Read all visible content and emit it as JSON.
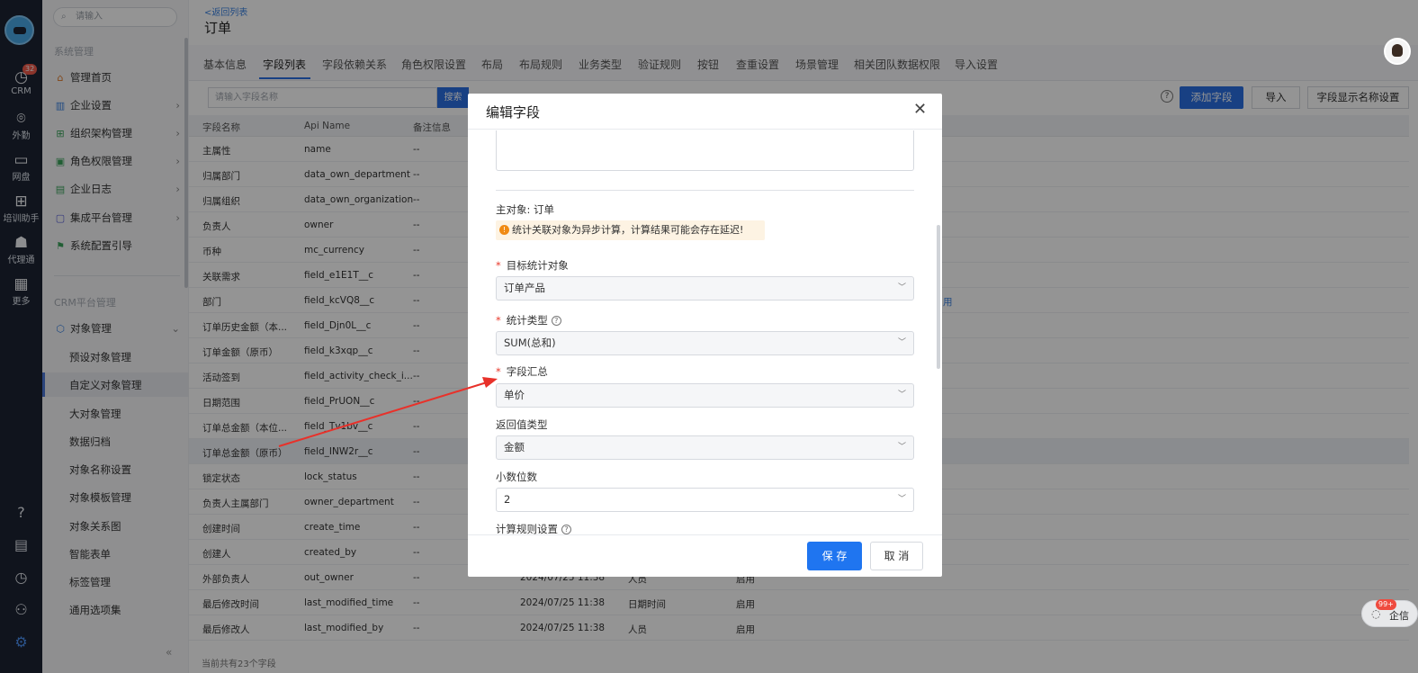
{
  "rail": {
    "items": [
      {
        "icon": "clock-icon",
        "glyph": "◷",
        "label": "CRM",
        "badge": "32"
      },
      {
        "icon": "location-pin-icon",
        "glyph": "⌾",
        "label": "外勤"
      },
      {
        "icon": "disk-icon",
        "glyph": "▭",
        "label": "网盘"
      },
      {
        "icon": "book-icon",
        "glyph": "⊞",
        "label": "培训助手"
      },
      {
        "icon": "agent-icon",
        "glyph": "☗",
        "label": "代理通"
      },
      {
        "icon": "grid-icon",
        "glyph": "▦",
        "label": "更多"
      }
    ],
    "bottom": [
      {
        "icon": "help-icon",
        "glyph": "?"
      },
      {
        "icon": "document-icon",
        "glyph": "▤"
      },
      {
        "icon": "history-icon",
        "glyph": "◷"
      },
      {
        "icon": "user-settings-icon",
        "glyph": "⚇"
      },
      {
        "icon": "gear-icon",
        "glyph": "⚙"
      }
    ]
  },
  "sidebar": {
    "search_placeholder": "请输入",
    "section1": "系统管理",
    "items": [
      "管理首页",
      "企业设置",
      "组织架构管理",
      "角色权限管理",
      "企业日志",
      "集成平台管理",
      "系统配置引导"
    ],
    "section2": "CRM平台管理",
    "group": "对象管理",
    "subitems": [
      "预设对象管理",
      "自定义对象管理",
      "大对象管理",
      "数据归档",
      "对象名称设置",
      "对象模板管理",
      "对象关系图",
      "智能表单",
      "标签管理",
      "通用选项集"
    ],
    "collapse": "«"
  },
  "header": {
    "back": "<返回列表",
    "title": "订单"
  },
  "tabs": [
    "基本信息",
    "字段列表",
    "字段依赖关系",
    "角色权限设置",
    "布局",
    "布局规则",
    "业务类型",
    "验证规则",
    "按钮",
    "查重设置",
    "场景管理",
    "相关团队数据权限",
    "导入设置"
  ],
  "toolbar": {
    "search_placeholder": "请输入字段名称",
    "search_button": "搜索",
    "help": "?",
    "add": "添加字段",
    "import": "导入",
    "display_setting": "字段显示名称设置"
  },
  "table": {
    "headers": [
      "字段名称",
      "Api Name",
      "备注信息"
    ],
    "rows": [
      [
        "主属性",
        "name",
        "--",
        "",
        "",
        ""
      ],
      [
        "归属部门",
        "data_own_department",
        "--",
        "",
        "",
        ""
      ],
      [
        "归属组织",
        "data_own_organization",
        "--",
        "",
        "",
        ""
      ],
      [
        "负责人",
        "owner",
        "--",
        "",
        "",
        ""
      ],
      [
        "币种",
        "mc_currency",
        "--",
        "",
        "",
        ""
      ],
      [
        "关联需求",
        "field_e1E1T__c",
        "--",
        "",
        "",
        ""
      ],
      [
        "部门",
        "field_kcVQ8__c",
        "--",
        "",
        "",
        "用"
      ],
      [
        "订单历史金额（本...",
        "field_Djn0L__c",
        "--",
        "",
        "",
        ""
      ],
      [
        "订单金额（原币）",
        "field_k3xqp__c",
        "--",
        "",
        "",
        ""
      ],
      [
        "活动签到",
        "field_activity_check_i...",
        "--",
        "",
        "",
        ""
      ],
      [
        "日期范围",
        "field_PrUON__c",
        "--",
        "",
        "",
        ""
      ],
      [
        "订单总金额（本位...",
        "field_Tv1bv__c",
        "--",
        "",
        "",
        ""
      ],
      [
        "订单总金额（原币）",
        "field_INW2r__c",
        "--",
        "",
        "",
        ""
      ],
      [
        "锁定状态",
        "lock_status",
        "--",
        "",
        "",
        ""
      ],
      [
        "负责人主属部门",
        "owner_department",
        "--",
        "",
        "",
        ""
      ],
      [
        "创建时间",
        "create_time",
        "--",
        "",
        "",
        ""
      ],
      [
        "创建人",
        "created_by",
        "--",
        "",
        "",
        ""
      ],
      [
        "外部负责人",
        "out_owner",
        "--",
        "2024/07/25 11:38",
        "人员",
        "启用"
      ],
      [
        "最后修改时间",
        "last_modified_time",
        "--",
        "2024/07/25 11:38",
        "日期时间",
        "启用"
      ],
      [
        "最后修改人",
        "last_modified_by",
        "--",
        "2024/07/25 11:38",
        "人员",
        "启用"
      ]
    ],
    "footer": "当前共有23个字段"
  },
  "chat": {
    "label": "企信",
    "badge": "99+"
  },
  "modal": {
    "title": "编辑字段",
    "close": "✕",
    "master_label": "主对象: 订单",
    "notice": "统计关联对象为异步计算，计算结果可能会存在延迟!",
    "fields": [
      {
        "label": "目标统计对象",
        "required": true,
        "help": false,
        "value": "订单产品",
        "disabled": true
      },
      {
        "label": "统计类型",
        "required": true,
        "help": true,
        "value": "SUM(总和)",
        "disabled": true
      },
      {
        "label": "字段汇总",
        "required": true,
        "help": false,
        "value": "单价",
        "disabled": true
      },
      {
        "label": "返回值类型",
        "required": false,
        "help": false,
        "value": "金额",
        "disabled": true
      },
      {
        "label": "小数位数",
        "required": false,
        "help": false,
        "value": "2",
        "disabled": false
      }
    ],
    "calc_rule_label": "计算规则设置",
    "save": "保 存",
    "cancel": "取 消"
  },
  "colors": {
    "accent": "#1f75f0",
    "required": "#e8392b",
    "annotation_arrow": "#e8312a",
    "warning": "#f08a13"
  }
}
